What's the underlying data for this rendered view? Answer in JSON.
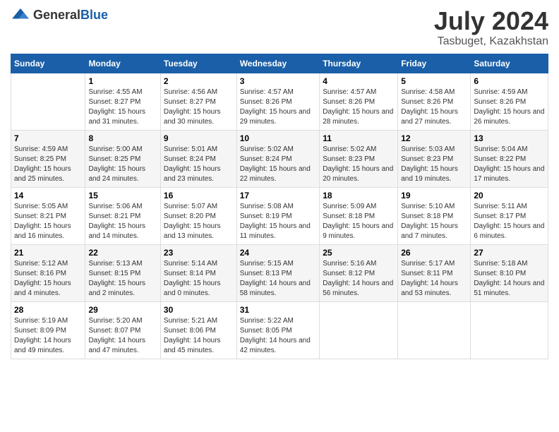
{
  "logo": {
    "general": "General",
    "blue": "Blue"
  },
  "title": "July 2024",
  "subtitle": "Tasbuget, Kazakhstan",
  "days_of_week": [
    "Sunday",
    "Monday",
    "Tuesday",
    "Wednesday",
    "Thursday",
    "Friday",
    "Saturday"
  ],
  "weeks": [
    [
      {
        "day": "",
        "sunrise": "",
        "sunset": "",
        "daylight": ""
      },
      {
        "day": "1",
        "sunrise": "Sunrise: 4:55 AM",
        "sunset": "Sunset: 8:27 PM",
        "daylight": "Daylight: 15 hours and 31 minutes."
      },
      {
        "day": "2",
        "sunrise": "Sunrise: 4:56 AM",
        "sunset": "Sunset: 8:27 PM",
        "daylight": "Daylight: 15 hours and 30 minutes."
      },
      {
        "day": "3",
        "sunrise": "Sunrise: 4:57 AM",
        "sunset": "Sunset: 8:26 PM",
        "daylight": "Daylight: 15 hours and 29 minutes."
      },
      {
        "day": "4",
        "sunrise": "Sunrise: 4:57 AM",
        "sunset": "Sunset: 8:26 PM",
        "daylight": "Daylight: 15 hours and 28 minutes."
      },
      {
        "day": "5",
        "sunrise": "Sunrise: 4:58 AM",
        "sunset": "Sunset: 8:26 PM",
        "daylight": "Daylight: 15 hours and 27 minutes."
      },
      {
        "day": "6",
        "sunrise": "Sunrise: 4:59 AM",
        "sunset": "Sunset: 8:26 PM",
        "daylight": "Daylight: 15 hours and 26 minutes."
      }
    ],
    [
      {
        "day": "7",
        "sunrise": "Sunrise: 4:59 AM",
        "sunset": "Sunset: 8:25 PM",
        "daylight": "Daylight: 15 hours and 25 minutes."
      },
      {
        "day": "8",
        "sunrise": "Sunrise: 5:00 AM",
        "sunset": "Sunset: 8:25 PM",
        "daylight": "Daylight: 15 hours and 24 minutes."
      },
      {
        "day": "9",
        "sunrise": "Sunrise: 5:01 AM",
        "sunset": "Sunset: 8:24 PM",
        "daylight": "Daylight: 15 hours and 23 minutes."
      },
      {
        "day": "10",
        "sunrise": "Sunrise: 5:02 AM",
        "sunset": "Sunset: 8:24 PM",
        "daylight": "Daylight: 15 hours and 22 minutes."
      },
      {
        "day": "11",
        "sunrise": "Sunrise: 5:02 AM",
        "sunset": "Sunset: 8:23 PM",
        "daylight": "Daylight: 15 hours and 20 minutes."
      },
      {
        "day": "12",
        "sunrise": "Sunrise: 5:03 AM",
        "sunset": "Sunset: 8:23 PM",
        "daylight": "Daylight: 15 hours and 19 minutes."
      },
      {
        "day": "13",
        "sunrise": "Sunrise: 5:04 AM",
        "sunset": "Sunset: 8:22 PM",
        "daylight": "Daylight: 15 hours and 17 minutes."
      }
    ],
    [
      {
        "day": "14",
        "sunrise": "Sunrise: 5:05 AM",
        "sunset": "Sunset: 8:21 PM",
        "daylight": "Daylight: 15 hours and 16 minutes."
      },
      {
        "day": "15",
        "sunrise": "Sunrise: 5:06 AM",
        "sunset": "Sunset: 8:21 PM",
        "daylight": "Daylight: 15 hours and 14 minutes."
      },
      {
        "day": "16",
        "sunrise": "Sunrise: 5:07 AM",
        "sunset": "Sunset: 8:20 PM",
        "daylight": "Daylight: 15 hours and 13 minutes."
      },
      {
        "day": "17",
        "sunrise": "Sunrise: 5:08 AM",
        "sunset": "Sunset: 8:19 PM",
        "daylight": "Daylight: 15 hours and 11 minutes."
      },
      {
        "day": "18",
        "sunrise": "Sunrise: 5:09 AM",
        "sunset": "Sunset: 8:18 PM",
        "daylight": "Daylight: 15 hours and 9 minutes."
      },
      {
        "day": "19",
        "sunrise": "Sunrise: 5:10 AM",
        "sunset": "Sunset: 8:18 PM",
        "daylight": "Daylight: 15 hours and 7 minutes."
      },
      {
        "day": "20",
        "sunrise": "Sunrise: 5:11 AM",
        "sunset": "Sunset: 8:17 PM",
        "daylight": "Daylight: 15 hours and 6 minutes."
      }
    ],
    [
      {
        "day": "21",
        "sunrise": "Sunrise: 5:12 AM",
        "sunset": "Sunset: 8:16 PM",
        "daylight": "Daylight: 15 hours and 4 minutes."
      },
      {
        "day": "22",
        "sunrise": "Sunrise: 5:13 AM",
        "sunset": "Sunset: 8:15 PM",
        "daylight": "Daylight: 15 hours and 2 minutes."
      },
      {
        "day": "23",
        "sunrise": "Sunrise: 5:14 AM",
        "sunset": "Sunset: 8:14 PM",
        "daylight": "Daylight: 15 hours and 0 minutes."
      },
      {
        "day": "24",
        "sunrise": "Sunrise: 5:15 AM",
        "sunset": "Sunset: 8:13 PM",
        "daylight": "Daylight: 14 hours and 58 minutes."
      },
      {
        "day": "25",
        "sunrise": "Sunrise: 5:16 AM",
        "sunset": "Sunset: 8:12 PM",
        "daylight": "Daylight: 14 hours and 56 minutes."
      },
      {
        "day": "26",
        "sunrise": "Sunrise: 5:17 AM",
        "sunset": "Sunset: 8:11 PM",
        "daylight": "Daylight: 14 hours and 53 minutes."
      },
      {
        "day": "27",
        "sunrise": "Sunrise: 5:18 AM",
        "sunset": "Sunset: 8:10 PM",
        "daylight": "Daylight: 14 hours and 51 minutes."
      }
    ],
    [
      {
        "day": "28",
        "sunrise": "Sunrise: 5:19 AM",
        "sunset": "Sunset: 8:09 PM",
        "daylight": "Daylight: 14 hours and 49 minutes."
      },
      {
        "day": "29",
        "sunrise": "Sunrise: 5:20 AM",
        "sunset": "Sunset: 8:07 PM",
        "daylight": "Daylight: 14 hours and 47 minutes."
      },
      {
        "day": "30",
        "sunrise": "Sunrise: 5:21 AM",
        "sunset": "Sunset: 8:06 PM",
        "daylight": "Daylight: 14 hours and 45 minutes."
      },
      {
        "day": "31",
        "sunrise": "Sunrise: 5:22 AM",
        "sunset": "Sunset: 8:05 PM",
        "daylight": "Daylight: 14 hours and 42 minutes."
      },
      {
        "day": "",
        "sunrise": "",
        "sunset": "",
        "daylight": ""
      },
      {
        "day": "",
        "sunrise": "",
        "sunset": "",
        "daylight": ""
      },
      {
        "day": "",
        "sunrise": "",
        "sunset": "",
        "daylight": ""
      }
    ]
  ]
}
